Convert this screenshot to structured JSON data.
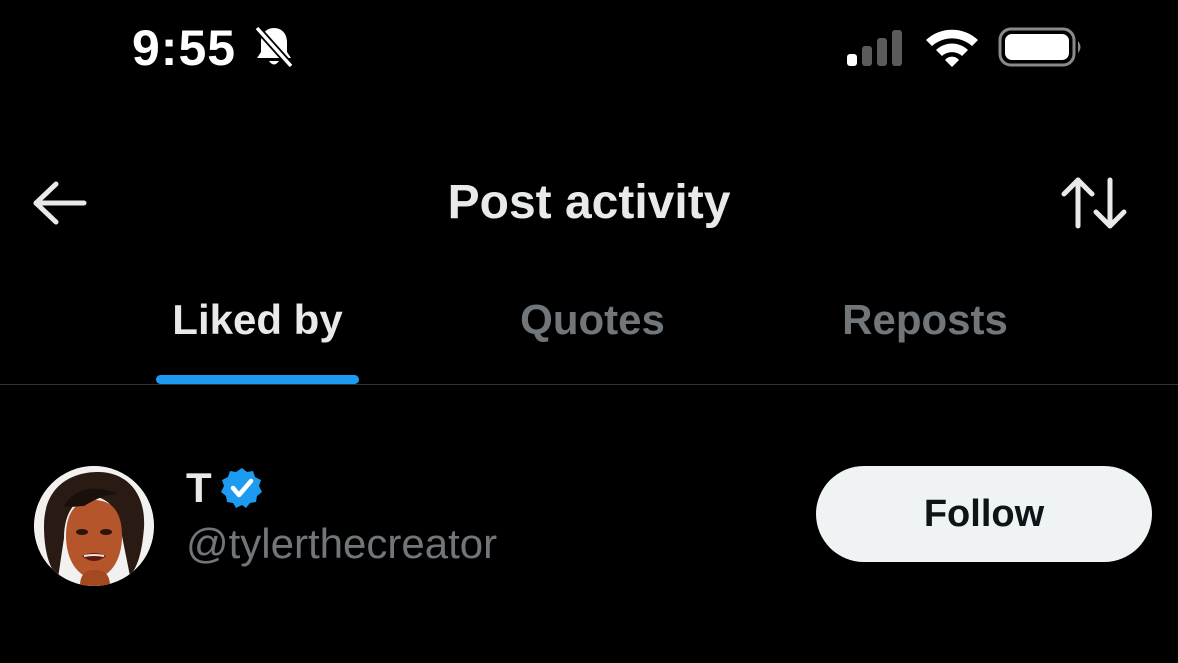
{
  "status_bar": {
    "time": "9:55",
    "icons": [
      "bell-slash-icon",
      "cellular-signal-icon",
      "wifi-icon",
      "battery-icon"
    ]
  },
  "header": {
    "title": "Post activity",
    "back_icon": "back-arrow-icon",
    "sort_icon": "sort-arrows-icon"
  },
  "tabs": [
    {
      "label": "Liked by",
      "active": true
    },
    {
      "label": "Quotes",
      "active": false
    },
    {
      "label": "Reposts",
      "active": false
    }
  ],
  "users": [
    {
      "name": "T",
      "verified": true,
      "handle": "@tylerthecreator",
      "follow_label": "Follow"
    }
  ],
  "colors": {
    "background": "#000000",
    "accent": "#1d9bf0",
    "text_primary": "#e7e9ea",
    "text_secondary": "#71767b",
    "button_bg": "#eff3f4",
    "button_text": "#0f1419"
  }
}
